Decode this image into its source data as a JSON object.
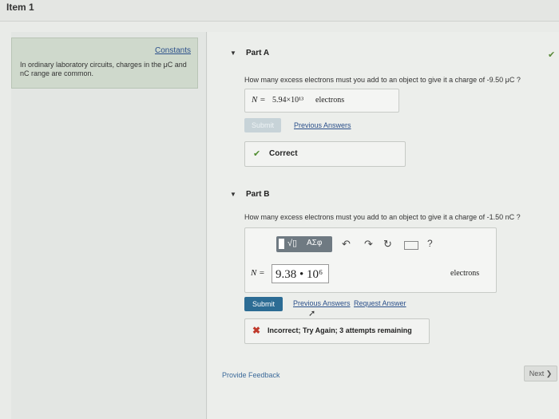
{
  "header": {
    "item_title": "Item 1"
  },
  "constants": {
    "link_label": "Constants",
    "text": "In ordinary laboratory circuits, charges in the μC and nC range are common."
  },
  "part_a": {
    "title": "Part A",
    "question": "How many excess electrons must you add to an object to give it a charge of -9.50 μC ?",
    "answer_label": "N =",
    "answer_value": "5.94×10¹³",
    "answer_unit": "electrons",
    "submit_label": "Submit",
    "previous_answers": "Previous Answers",
    "feedback": "Correct"
  },
  "part_b": {
    "title": "Part B",
    "question": "How many excess electrons must you add to an object to give it a charge of -1.50 nC ?",
    "toolbar_symbols": "ΑΣφ",
    "answer_label": "N =",
    "input_value": "9.38 • 10⁶",
    "answer_unit": "electrons",
    "submit_label": "Submit",
    "previous_answers": "Previous Answers",
    "request_answer": "Request Answer",
    "feedback": "Incorrect; Try Again; 3 attempts remaining"
  },
  "footer": {
    "provide_feedback": "Provide Feedback",
    "next_label": "Next ❯"
  }
}
